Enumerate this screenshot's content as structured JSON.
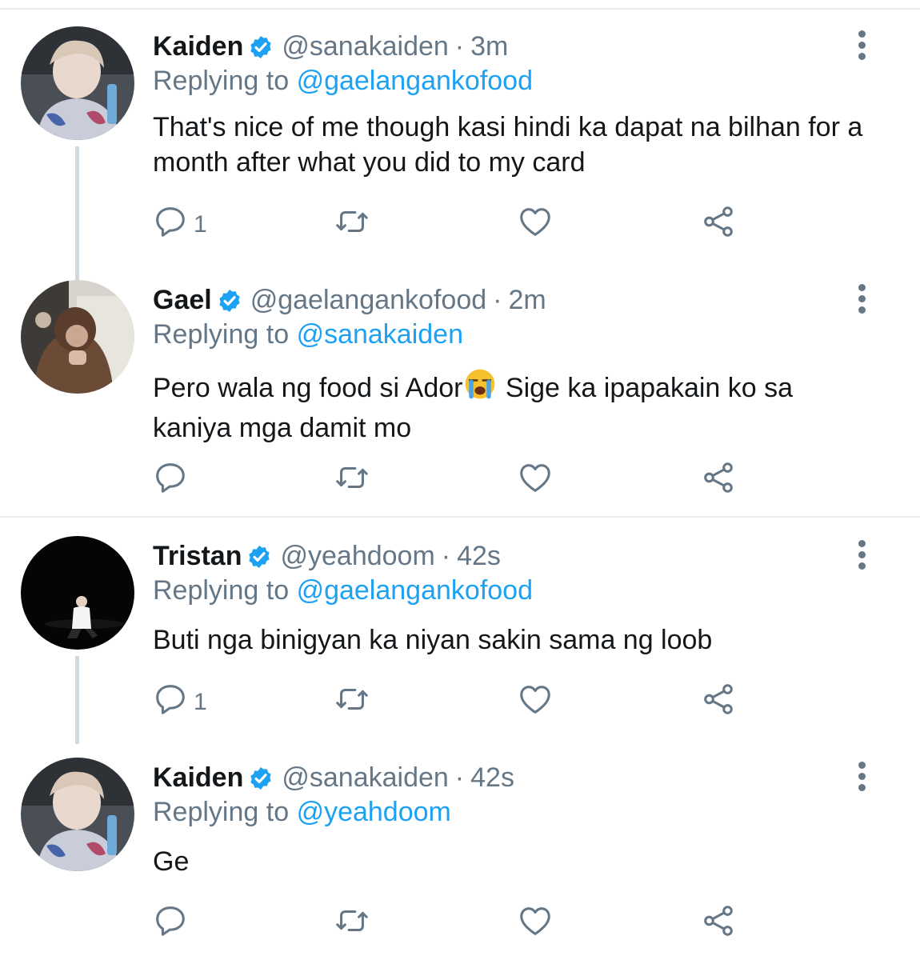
{
  "tweets": [
    {
      "name": "Kaiden",
      "handle": "@sanakaiden",
      "dot": "·",
      "time": "3m",
      "replying_label": "Replying to",
      "replying_to": "@gaelangankofood",
      "text": "That's nice of me though kasi hindi ka dapat na bilhan for a month after what you did to my card",
      "text_after_emoji": "",
      "reply_count": "1",
      "avatar_icon": "profile-photo-avatar"
    },
    {
      "name": "Gael",
      "handle": "@gaelangankofood",
      "dot": "·",
      "time": "2m",
      "replying_label": "Replying to",
      "replying_to": "@sanakaiden",
      "text": "Pero wala ng food si Ador",
      "text_after_emoji": " Sige ka ipapakain ko sa kaniya mga damit mo",
      "emoji_icon": "loudly-crying-face-emoji",
      "reply_count": "",
      "avatar_icon": "profile-photo-avatar"
    },
    {
      "name": "Tristan",
      "handle": "@yeahdoom",
      "dot": "·",
      "time": "42s",
      "replying_label": "Replying to",
      "replying_to": "@gaelangankofood",
      "text": "Buti nga binigyan ka niyan sakin sama ng loob",
      "text_after_emoji": "",
      "reply_count": "1",
      "avatar_icon": "profile-photo-avatar"
    },
    {
      "name": "Kaiden",
      "handle": "@sanakaiden",
      "dot": "·",
      "time": "42s",
      "replying_label": "Replying to",
      "replying_to": "@yeahdoom",
      "text": "Ge",
      "text_after_emoji": "",
      "reply_count": "",
      "avatar_icon": "profile-photo-avatar"
    }
  ],
  "icons": {
    "verified": "verified-badge-icon",
    "more": "more-vertical-icon",
    "reply": "reply-icon",
    "retweet": "retweet-icon",
    "like": "heart-icon",
    "share": "share-icon"
  },
  "colors": {
    "link": "#1da1f2",
    "secondary_text": "#657786",
    "primary_text": "#14171a",
    "verified": "#1da1f2",
    "separator": "#e6ecf0"
  }
}
